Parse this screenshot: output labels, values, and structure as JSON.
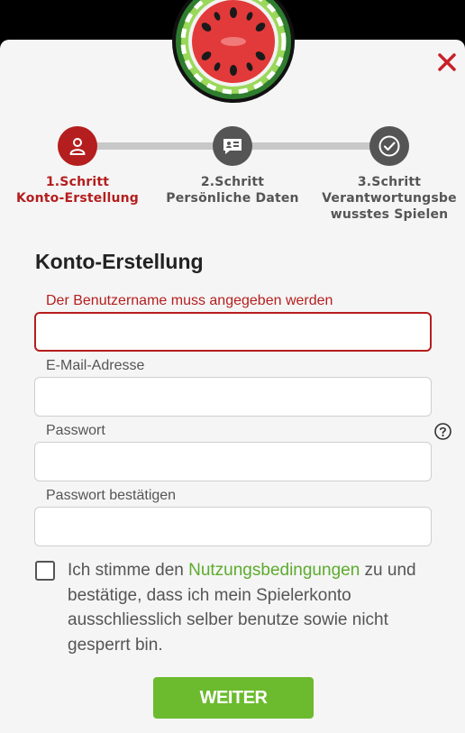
{
  "steps": [
    {
      "number": "1.Schritt",
      "name": "Konto-Erstellung",
      "icon": "user-icon",
      "state": "active"
    },
    {
      "number": "2.Schritt",
      "name": "Persönliche Daten",
      "icon": "id-card-icon",
      "state": "inactive"
    },
    {
      "number": "3.Schritt",
      "name_line1": "Verantwortungsbe",
      "name_line2": "wusstes Spielen",
      "icon": "check-icon",
      "state": "inactive"
    }
  ],
  "form": {
    "title": "Konto-Erstellung",
    "username_error": "Der Benutzername muss angegeben werden",
    "username_value": "",
    "email_label": "E-Mail-Adresse",
    "email_value": "",
    "password_label": "Passwort",
    "password_value": "",
    "password_confirm_label": "Passwort bestätigen",
    "password_confirm_value": ""
  },
  "terms": {
    "text_before": "Ich stimme den ",
    "link": "Nutzungsbedingungen",
    "text_after": " zu und bestätige, dass ich mein Spielerkonto ausschliesslich selber benutze sowie nicht gesperrt bin.",
    "checked": false
  },
  "submit_label": "WEITER",
  "colors": {
    "accent_red": "#b51e1e",
    "inactive_gray": "#555555",
    "button_green": "#6cbb2e",
    "link_green": "#5cab2e"
  }
}
